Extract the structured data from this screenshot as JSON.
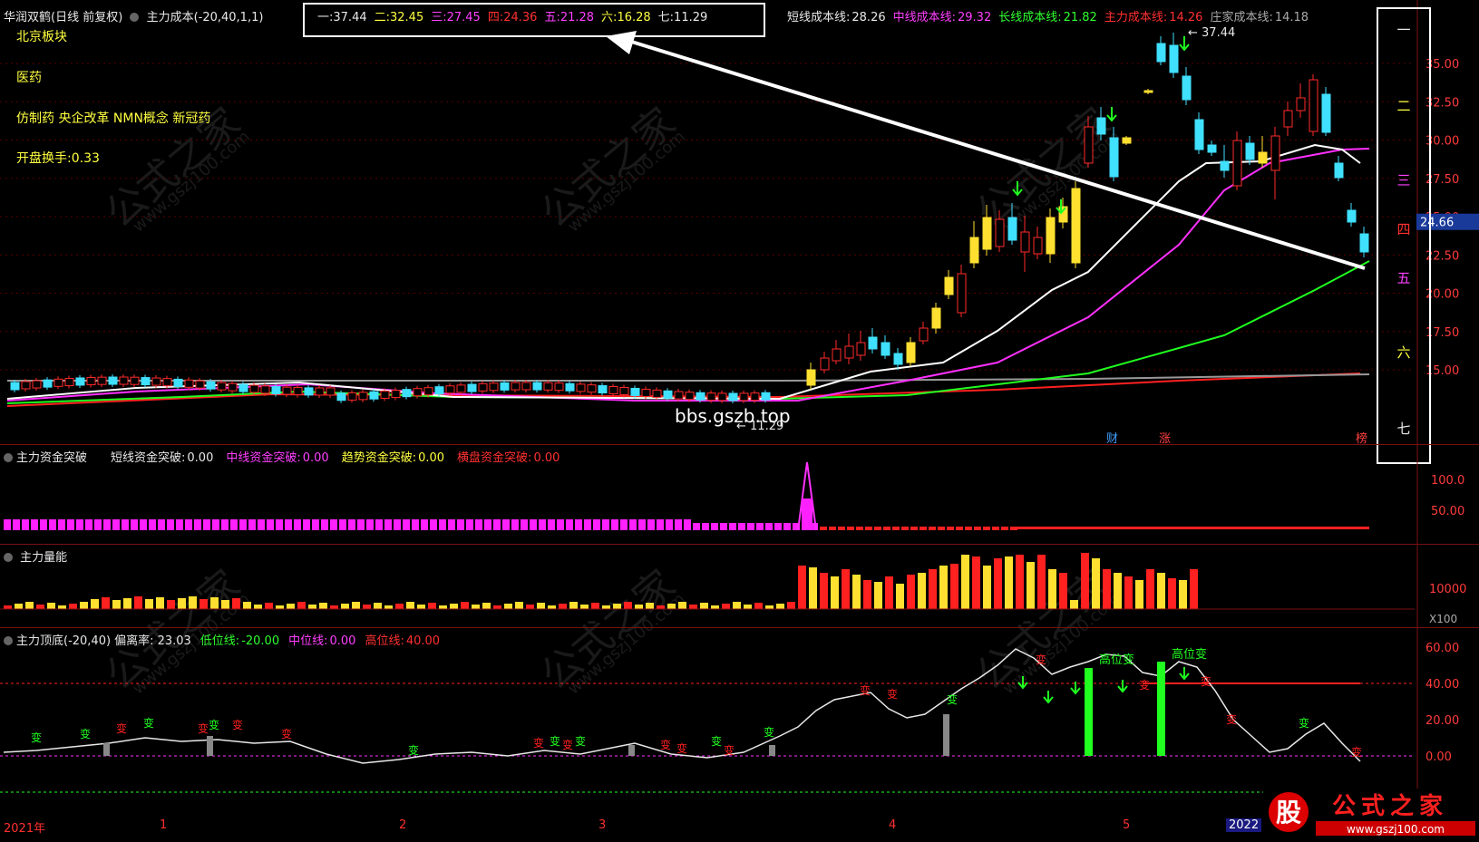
{
  "header": {
    "stock_name": "华润双鹤(日线 前复权)",
    "indicator": "主力成本(-20,40,1,1)",
    "levels": [
      {
        "label": "一:",
        "value": "37.44",
        "color": "#e8e8e8"
      },
      {
        "label": "二:",
        "value": "32.45",
        "color": "#ffff40"
      },
      {
        "label": "三:",
        "value": "27.45",
        "color": "#ff40ff"
      },
      {
        "label": "四:",
        "value": "24.36",
        "color": "#ff3030"
      },
      {
        "label": "五:",
        "value": "21.28",
        "color": "#ff40ff"
      },
      {
        "label": "六:",
        "value": "16.28",
        "color": "#ffff40"
      },
      {
        "label": "七:",
        "value": "11.29",
        "color": "#e8e8e8"
      }
    ],
    "cost_lines": [
      {
        "label": "短线成本线:",
        "value": "28.26",
        "color": "#e8e8e8"
      },
      {
        "label": "中线成本线:",
        "value": "29.32",
        "color": "#ff40ff"
      },
      {
        "label": "长线成本线:",
        "value": "21.82",
        "color": "#30ff30"
      },
      {
        "label": "主力成本线:",
        "value": "14.26",
        "color": "#ff3030"
      },
      {
        "label": "庄家成本线:",
        "value": "14.18",
        "color": "#aaaaaa"
      }
    ]
  },
  "info": {
    "board": "北京板块",
    "industry": "医药",
    "concepts": "仿制药 央企改革 NMN概念 新冠药",
    "turnover": "开盘换手:0.33"
  },
  "right_levels": [
    "一",
    "二",
    "三",
    "四",
    "五",
    "六",
    "七"
  ],
  "price_axis": [
    "35.00",
    "32.50",
    "30.00",
    "27.50",
    "25.00",
    "22.50",
    "20.00",
    "17.50",
    "15.00"
  ],
  "current_price": "24.66",
  "chart_marks": {
    "high": "37.44",
    "low": "11.29",
    "watermark_site": "bbs.gszb.top",
    "badges": [
      "财",
      "涨",
      "榜"
    ]
  },
  "breakout_panel": {
    "title": "主力资金突破",
    "items": [
      {
        "label": "短线资金突破:",
        "value": "0.00",
        "color": "#e8e8e8"
      },
      {
        "label": "中线资金突破:",
        "value": "0.00",
        "color": "#ff40ff"
      },
      {
        "label": "趋势资金突破:",
        "value": "0.00",
        "color": "#ffff40"
      },
      {
        "label": "横盘资金突破:",
        "value": "0.00",
        "color": "#ff3030"
      }
    ],
    "axis": [
      "100.0",
      "50.00"
    ]
  },
  "volume_panel": {
    "title": "主力量能",
    "axis": [
      "10000",
      "X100"
    ]
  },
  "osc_panel": {
    "title": "主力顶底(-20,40)",
    "deviation": "偏离率: 23.03",
    "items": [
      {
        "label": "低位线:",
        "value": "-20.00",
        "color": "#30ff30"
      },
      {
        "label": "中位线:",
        "value": "0.00",
        "color": "#ff40ff"
      },
      {
        "label": "高位线:",
        "value": "40.00",
        "color": "#ff3030"
      }
    ],
    "axis": [
      "60.00",
      "40.00",
      "20.00",
      "0.00"
    ],
    "marks": {
      "change": "变",
      "high_change": "高位变"
    }
  },
  "dates": [
    "2021年",
    "1",
    "2",
    "3",
    "4",
    "5",
    "2022"
  ],
  "watermark": {
    "text": "公式之家",
    "url": "www.gszj100.com",
    "logo_text": "公式之家",
    "logo_badge": "股",
    "logo_url": "www.gszj100.com"
  },
  "colors": {
    "up": "#ff2a2a",
    "down": "#40e0ff",
    "yellow": "#ffe030",
    "short": "#ffffff",
    "mid": "#ff30ff",
    "long": "#20ff20",
    "main": "#ff2020",
    "zhuang": "#999999"
  }
}
